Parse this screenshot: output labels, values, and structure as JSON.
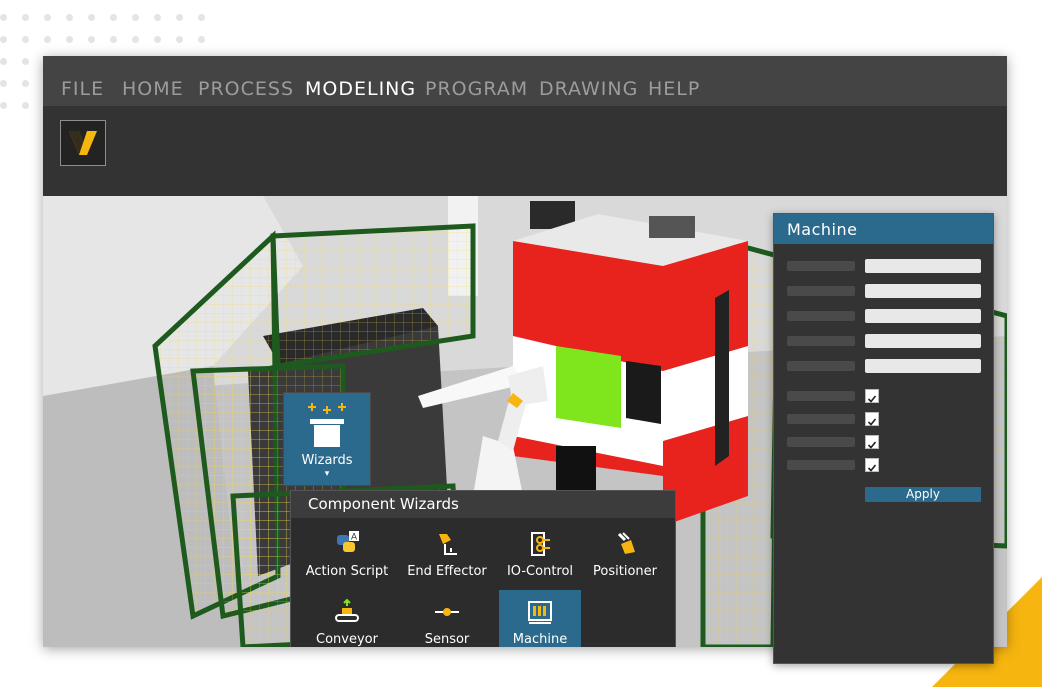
{
  "menu": {
    "items": [
      {
        "label": "FILE"
      },
      {
        "label": "HOME"
      },
      {
        "label": "PROCESS"
      },
      {
        "label": "MODELING",
        "active": true
      },
      {
        "label": "PROGRAM"
      },
      {
        "label": "DRAWING"
      },
      {
        "label": "HELP"
      }
    ]
  },
  "wizards_button": {
    "label": "Wizards",
    "arrow": "▾",
    "icon": "wizard-hat-icon"
  },
  "component_wizards": {
    "title": "Component Wizards",
    "items": [
      {
        "label": "Action Script",
        "icon": "python-script-icon"
      },
      {
        "label": "End Effector",
        "icon": "gripper-icon"
      },
      {
        "label": "IO-Control",
        "icon": "io-control-icon"
      },
      {
        "label": "Positioner",
        "icon": "positioner-icon"
      },
      {
        "label": "Conveyor",
        "icon": "conveyor-icon"
      },
      {
        "label": "Sensor",
        "icon": "sensor-icon"
      },
      {
        "label": "Machine",
        "icon": "machine-icon",
        "selected": true
      }
    ]
  },
  "machine_panel": {
    "title": "Machine",
    "apply_label": "Apply",
    "checkboxes": [
      true,
      true,
      true,
      true
    ]
  },
  "colors": {
    "accent": "#2b6a8c",
    "brand_yellow": "#f7b50f",
    "machine_red": "#e8231e",
    "screen_green": "#7fe51c",
    "fence_green": "#1e5a1e"
  }
}
